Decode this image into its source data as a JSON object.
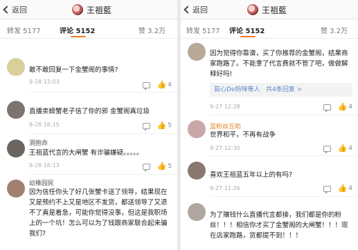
{
  "left": {
    "back_label": "返回",
    "title": "王祖藍",
    "tabs": {
      "repost": "转发 5177",
      "comment": "评论 5152",
      "like": "赞 3.2万"
    },
    "comments": [
      {
        "name": "",
        "text": "敢不敢回复一下金蟹阁的事情?",
        "time": "9-28 13:03",
        "likes": "4"
      },
      {
        "name": "",
        "text": "直播卖螃蟹老子信了你的邪 金蟹阁真垃圾",
        "time": "9-28 16:15",
        "likes": "5"
      },
      {
        "name": "洞抱命",
        "text": "王祖蓝代言的大闸蟹 有诈骗嫌疑。。。。。",
        "time": "9-28 16:13",
        "likes": "5"
      },
      {
        "name": "幼稚园民",
        "text": "因为信任你头了好几张蟹卡送了领导，结果现在又是预约不上又是地区不发货，都送领导了又退不了真是着急，可能你觉得没事，但这是我职场上的一个坑！怎么可以为了钱跟商家联合起来骗我们?",
        "time": "",
        "likes": ""
      }
    ]
  },
  "right": {
    "back_label": "返回",
    "title": "王祖藍",
    "tabs": {
      "repost": "转发 5177",
      "comment": "评论 5152",
      "like": "赞 3.2万"
    },
    "comments": [
      {
        "name": "",
        "text": "因为觉得你靠谱，买了你推荐的金蟹阁，结果商家跑路了。不能拿了代言费就不管了吧，做做解释好吗!",
        "time": "9-27 12:28",
        "likes": "4",
        "reply_nick": "茹心De妈咪等人",
        "reply_more": "共4条回复 >"
      },
      {
        "name": "蓝粉丝互助",
        "badge": "",
        "text": "世界和平，不再有战争",
        "time": "9-27 12:30",
        "likes": "4"
      },
      {
        "name": "",
        "text": "喜欢王祖蓝五年以上的有吗?",
        "time": "9-27 11:26",
        "likes": "4"
      },
      {
        "name": "",
        "text": "为了赚钱什么直播代言都接，我们都是你的粉丝！！！相信你才买了金蟹阁的大闸蟹！！！现在店家跑路，货都提不到！！！",
        "time": "",
        "likes": ""
      }
    ]
  },
  "colors": {
    "accent": "#f47a20",
    "link": "#5b8ac7"
  }
}
